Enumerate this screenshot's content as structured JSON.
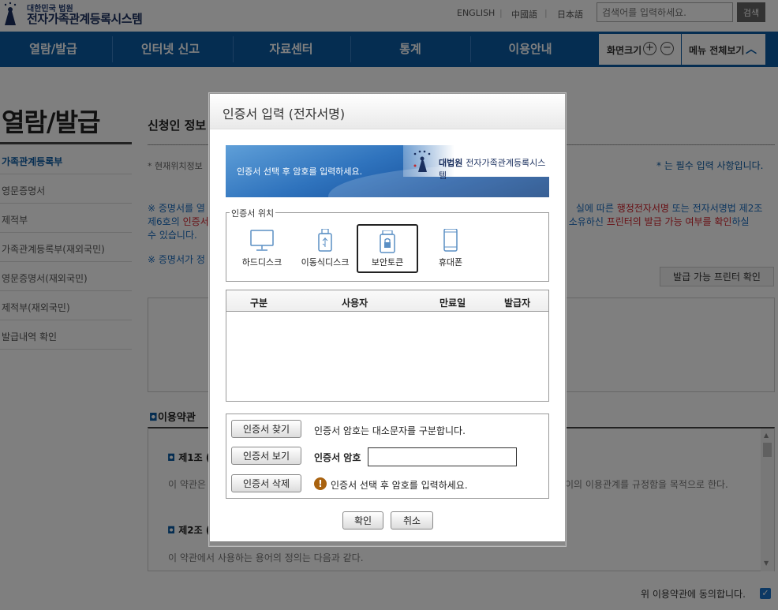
{
  "header": {
    "logo_small": "대한민국 법원",
    "logo_big": "전자가족관계등록시스템",
    "languages": [
      "ENGLISH",
      "中國語",
      "日本語"
    ],
    "search_placeholder": "검색어를 입력하세요.",
    "search_button": "검색"
  },
  "gnb": {
    "items": [
      "열람/발급",
      "인터넷 신고",
      "자료센터",
      "통계",
      "이용안내"
    ],
    "zoom_label": "화면크기",
    "zoom_in": "+",
    "zoom_out": "−",
    "menu_all": "메뉴 전체보기"
  },
  "lnb": {
    "title": "열람/발급",
    "items": [
      "가족관계등록부",
      "영문증명서",
      "제적부",
      "가족관계등록부(재외국민)",
      "영문증명서(재외국민)",
      "제적부(재외국민)",
      "발급내역 확인"
    ]
  },
  "content": {
    "title": "신청인 정보",
    "location_note": "* 현재위치정보",
    "required_note": "* 는 필수 입력 사항입니다.",
    "cert_note_a": "※ 증명서를 열",
    "cert_note_b": "실에 따른 ",
    "cert_note_red1": "행정전자서명",
    "cert_note_c": " 또는 전자서명법 제2조",
    "cert_note_d": "제6호의 ",
    "cert_note_red2": "인증서",
    "cert_note_e": "소유하신 ",
    "cert_note_red3": "프린터의 발급 가능 여부를 확인",
    "cert_note_f": "하실",
    "cert_note_g": "수 있습니다.",
    "cert_note2": "※ 증명서가 정",
    "printer_button": "발급 가능 프린터 확인",
    "terms_title": "이용약관",
    "art1": "제1조 (",
    "art1_text_left": "이 약관은",
    "art1_text_right": "이의 이용관계를 규정함을 목적으로 한다.",
    "art2": "제2조 (",
    "art2_text": "이 약관에서 사용하는 용어의 정의는 다음과 같다.",
    "agree_label": "위 이용약관에 동의합니다."
  },
  "modal": {
    "title": "인증서 입력 (전자서명)",
    "banner_text": "인증서 선택 후 암호를 입력하세요.",
    "banner_logo_a": "대법원",
    "banner_logo_b": "전자가족관계등록시스템",
    "location_legend": "인증서 위치",
    "locations": [
      {
        "label": "하드디스크",
        "icon": "monitor-icon",
        "selected": false
      },
      {
        "label": "이동식디스크",
        "icon": "usb-icon",
        "selected": false
      },
      {
        "label": "보안토큰",
        "icon": "security-token-icon",
        "selected": true
      },
      {
        "label": "휴대폰",
        "icon": "mobile-phone-icon",
        "selected": false
      }
    ],
    "table_headers": [
      "구분",
      "사용자",
      "만료일",
      "발급자"
    ],
    "btn_find": "인증서 찾기",
    "btn_view": "인증서 보기",
    "btn_delete": "인증서 삭제",
    "case_note": "인증서 암호는 대소문자를 구분합니다.",
    "password_label": "인증서 암호",
    "password_value": "",
    "warn_text": "인증서 선택 후 암호를 입력하세요.",
    "ok": "확인",
    "cancel": "취소"
  },
  "colors": {
    "brand_blue": "#0b5aa3",
    "highlight_red": "#d0202a",
    "overlay": "rgba(0,0,0,0.5)"
  }
}
